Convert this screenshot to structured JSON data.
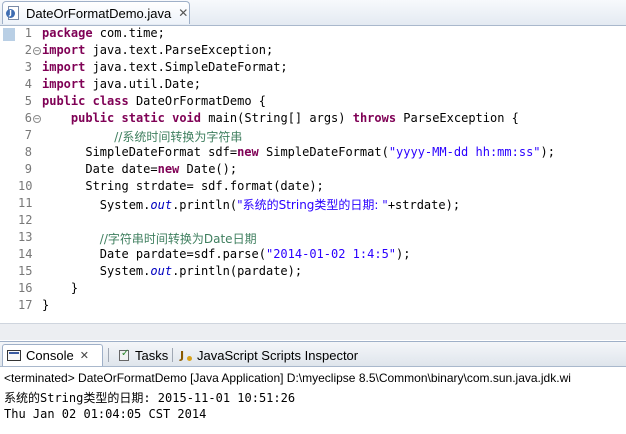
{
  "editor": {
    "tab_label": "DateOrFormatDemo.java",
    "close_glyph": "✕",
    "line_numbers": [
      "1",
      "2",
      "3",
      "4",
      "5",
      "6",
      "7",
      "8",
      "9",
      "10",
      "11",
      "12",
      "13",
      "14",
      "15",
      "16",
      "17"
    ]
  },
  "code": {
    "l1_kw": "package",
    "l1_rest": " com.time;",
    "l2_kw": "import",
    "l2_rest": " java.text.ParseException;",
    "l3_kw": "import",
    "l3_rest": " java.text.SimpleDateFormat;",
    "l4_kw": "import",
    "l4_rest": " java.util.Date;",
    "l5_kw1": "public",
    "l5_kw2": "class",
    "l5_rest": " DateOrFormatDemo {",
    "l6_kw1": "public",
    "l6_kw2": "static",
    "l6_kw3": "void",
    "l6_mid": " main(String[] args) ",
    "l6_kw4": "throws",
    "l6_rest": " ParseException {",
    "l7_comment": "//系统时间转换为字符串",
    "l8_a": "SimpleDateFormat sdf=",
    "l8_kw": "new",
    "l8_b": " SimpleDateFormat(",
    "l8_str": "\"yyyy-MM-dd hh:mm:ss\"",
    "l8_c": ");",
    "l9_a": "Date date=",
    "l9_kw": "new",
    "l9_b": " Date();",
    "l10": "String strdate= sdf.format(date);",
    "l11_a": "System.",
    "l11_out": "out",
    "l11_b": ".println(",
    "l11_str": "\"系统的String类型的日期: \"",
    "l11_c": "+strdate);",
    "l12": "",
    "l13_comment": "//字符串时间转换为Date日期",
    "l14_a": "Date pardate=sdf.parse(",
    "l14_str": "\"2014-01-02 1:4:5\"",
    "l14_b": ");",
    "l15_a": "System.",
    "l15_out": "out",
    "l15_b": ".println(pardate);",
    "l16": "}",
    "l17": "}"
  },
  "console": {
    "tabs": [
      {
        "label": "Console",
        "close": "✕"
      },
      {
        "label": "Tasks"
      },
      {
        "label": "JavaScript Scripts Inspector"
      }
    ],
    "status": "<terminated> DateOrFormatDemo [Java Application] D:\\myeclipse 8.5\\Common\\binary\\com.sun.java.jdk.wi",
    "output": [
      "系统的String类型的日期: 2015-11-01 10:51:26",
      "Thu Jan 02 01:04:05 CST 2014"
    ]
  },
  "icons": {
    "fold_open": "−"
  },
  "colors": {
    "keyword": "#7f0055",
    "string": "#2a00ff",
    "comment": "#3f7f5f",
    "field": "#0000c0"
  }
}
